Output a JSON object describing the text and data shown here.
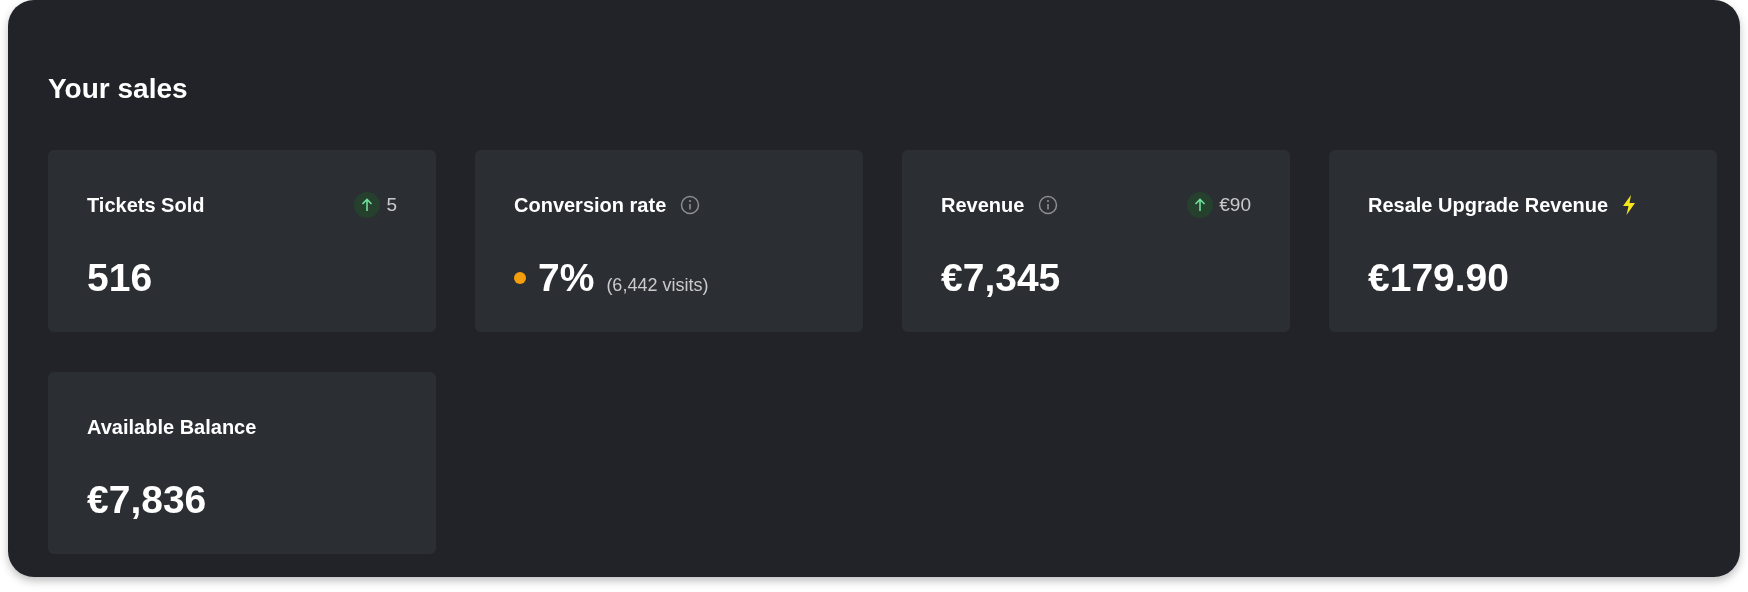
{
  "title": "Your sales",
  "cards": [
    {
      "label": "Tickets Sold",
      "info": false,
      "trend": "5",
      "value": "516"
    },
    {
      "label": "Conversion rate",
      "info": true,
      "color": "#f59e0b",
      "value": "7%",
      "note": "(6,442 visits)"
    },
    {
      "label": "Revenue",
      "info": true,
      "trend": "€90",
      "value": "€7,345"
    },
    {
      "label": "Resale Upgrade Revenue",
      "info": false,
      "bolt": true,
      "value": "€179.90"
    },
    {
      "label": "Available Balance",
      "info": false,
      "value": "€7,836"
    }
  ]
}
